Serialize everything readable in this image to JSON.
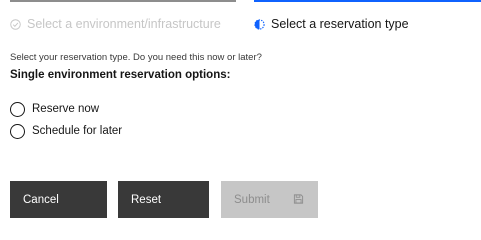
{
  "stepper": {
    "steps": [
      {
        "label": "Select a environment/infrastructure",
        "state": "complete",
        "icon": "checkmark-outline-icon"
      },
      {
        "label": "Select a reservation type",
        "state": "current",
        "icon": "half-circle-icon"
      }
    ]
  },
  "form": {
    "intro": "Select your reservation type. Do you need this now or later?",
    "heading": "Single environment reservation options:",
    "options": [
      {
        "label": "Reserve now",
        "selected": false
      },
      {
        "label": "Schedule for later",
        "selected": false
      }
    ]
  },
  "actions": {
    "cancel_label": "Cancel",
    "reset_label": "Reset",
    "submit_label": "Submit",
    "submit_icon": "save-icon",
    "submit_disabled": true
  },
  "colors": {
    "accent": "#0f62fe",
    "primary_button": "#393939",
    "disabled_button": "#c6c6c6",
    "disabled_text": "#8d8d8d"
  }
}
